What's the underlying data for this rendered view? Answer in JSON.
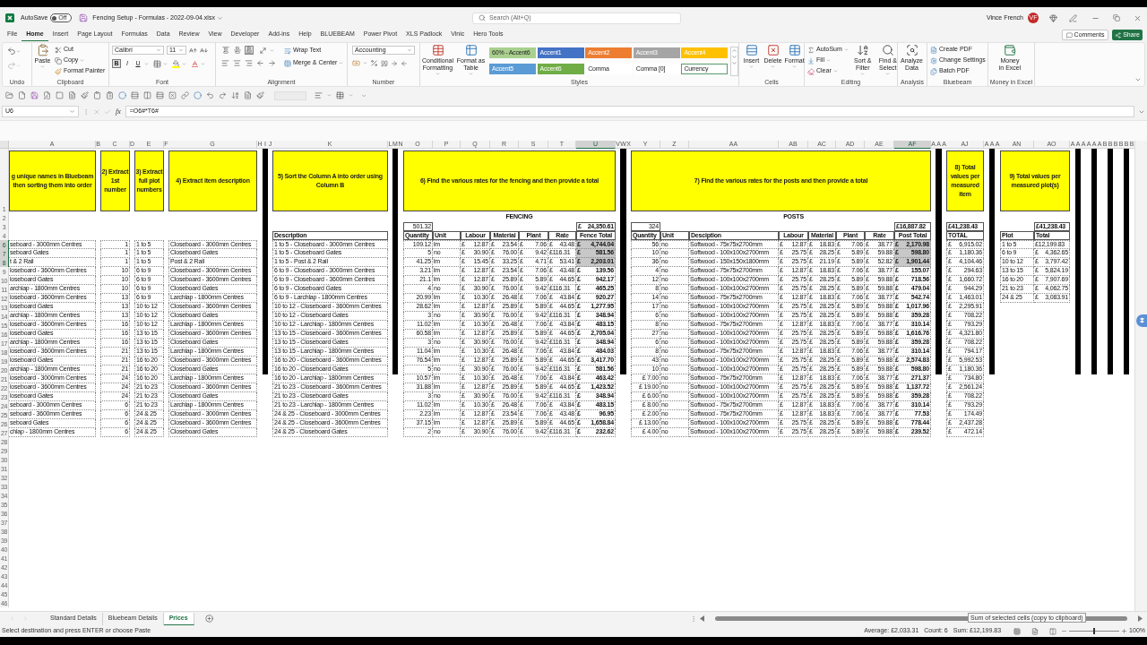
{
  "title_bar": {
    "autosave": {
      "label": "AutoSave",
      "state_label": "Off",
      "on": false
    },
    "file_name": "Fencing Setup - Formulas - 2022-09-04.xlsx",
    "search_placeholder": "Search (Alt+Q)",
    "user_name": "Vince French",
    "user_initials": "VF"
  },
  "menu_tabs": [
    {
      "label": "File",
      "selected": false
    },
    {
      "label": "Home",
      "selected": true
    },
    {
      "label": "Insert",
      "selected": false
    },
    {
      "label": "Page Layout",
      "selected": false
    },
    {
      "label": "Formulas",
      "selected": false
    },
    {
      "label": "Data",
      "selected": false
    },
    {
      "label": "Review",
      "selected": false
    },
    {
      "label": "View",
      "selected": false
    },
    {
      "label": "Developer",
      "selected": false
    },
    {
      "label": "Add-ins",
      "selected": false
    },
    {
      "label": "Help",
      "selected": false
    },
    {
      "label": "BLUEBEAM",
      "selected": false
    },
    {
      "label": "Power Pivot",
      "selected": false
    },
    {
      "label": "XLS Padlock",
      "selected": false
    },
    {
      "label": "Vinic",
      "selected": false
    },
    {
      "label": "Hero Tools",
      "selected": false
    }
  ],
  "comments": "Comments",
  "share": "Share",
  "ribbon": {
    "groups": [
      {
        "kind": "undo",
        "label": "Undo"
      },
      {
        "kind": "clipboard",
        "label": "Clipboard",
        "paste": "Paste",
        "items": [
          "Cut",
          "Copy",
          "Format Painter"
        ]
      },
      {
        "kind": "font",
        "label": "Font",
        "font": "Calibri",
        "size": "11",
        "format_buttons": [
          {
            "label": "B",
            "selected": true
          },
          {
            "label": "I",
            "selected": false
          },
          {
            "label": "U",
            "selected": false
          }
        ]
      },
      {
        "kind": "alignment",
        "label": "Alignment",
        "align_buttons": [
          {
            "selected": false
          },
          {
            "selected": false
          },
          {
            "selected": true
          }
        ],
        "wrap": "Wrap Text",
        "merge": "Merge & Center"
      },
      {
        "kind": "number",
        "label": "Number",
        "format": "Accounting"
      },
      {
        "kind": "styles",
        "label": "Styles",
        "conditional": "Conditional Formatting",
        "table": "Format as Table",
        "cells": [
          {
            "label": "60% - Accent6",
            "kind": "tint",
            "color": "#a9d08e",
            "selected": false
          },
          {
            "label": "Accent1",
            "kind": "accent",
            "color": "#4472c4",
            "selected": false
          },
          {
            "label": "Accent2",
            "kind": "accent",
            "color": "#ed7d31",
            "selected": false
          },
          {
            "label": "Accent3",
            "kind": "accent",
            "color": "#a5a5a5",
            "selected": false
          },
          {
            "label": "Accent4",
            "kind": "accent",
            "color": "#ffc000",
            "selected": false
          },
          {
            "label": "Accent5",
            "kind": "accent",
            "color": "#5b9bd5",
            "selected": false
          },
          {
            "label": "Accent6",
            "kind": "accent",
            "color": "#70ad47",
            "selected": false
          },
          {
            "label": "Comma",
            "kind": "number",
            "selected": false
          },
          {
            "label": "Comma [0]",
            "kind": "number",
            "selected": false
          },
          {
            "label": "Currency",
            "kind": "number",
            "selected": true
          }
        ]
      },
      {
        "kind": "cells",
        "label": "Cells",
        "buttons": [
          "Insert",
          "Delete",
          "Format"
        ]
      },
      {
        "kind": "editing",
        "label": "Editing",
        "items": [
          "AutoSum",
          "Fill",
          "Clear"
        ],
        "buttons": [
          "Sort & Filter",
          "Find & Select"
        ]
      },
      {
        "kind": "analysis",
        "label": "Analysis",
        "button": "Analyze Data"
      },
      {
        "kind": "bluebeam",
        "label": "Bluebeam",
        "items": [
          "Create PDF",
          "Change Settings",
          "Batch PDF"
        ]
      },
      {
        "kind": "money",
        "label": "Money in Excel",
        "button": "Money in Excel"
      }
    ]
  },
  "formula_bar": {
    "name_box": "U6",
    "function_label": "fx",
    "formula": "=O6#*T6#"
  },
  "sheet": {
    "column_headers": [
      {
        "label": "A",
        "selected": false
      },
      {
        "label": "B",
        "selected": false
      },
      {
        "label": "C",
        "selected": false
      },
      {
        "label": "D",
        "selected": false
      },
      {
        "label": "E",
        "selected": false
      },
      {
        "label": "F",
        "selected": false
      },
      {
        "label": "G",
        "selected": false
      },
      {
        "label": "H",
        "selected": false
      },
      {
        "label": "I",
        "selected": false
      },
      {
        "label": "J",
        "selected": false
      },
      {
        "label": "K",
        "selected": false
      },
      {
        "label": "L",
        "selected": false
      },
      {
        "label": "M",
        "selected": false
      },
      {
        "label": "N",
        "selected": false
      },
      {
        "label": "O",
        "selected": false
      },
      {
        "label": "P",
        "selected": false
      },
      {
        "label": "Q",
        "selected": false
      },
      {
        "label": "R",
        "selected": false
      },
      {
        "label": "S",
        "selected": false
      },
      {
        "label": "T",
        "selected": false
      },
      {
        "label": "U",
        "selected": true
      },
      {
        "label": "V",
        "selected": false
      },
      {
        "label": "W",
        "selected": false
      },
      {
        "label": "X",
        "selected": false
      },
      {
        "label": "Y",
        "selected": false
      },
      {
        "label": "Z",
        "selected": false
      },
      {
        "label": "AA",
        "selected": false
      },
      {
        "label": "AB",
        "selected": false
      },
      {
        "label": "AC",
        "selected": false
      },
      {
        "label": "AD",
        "selected": false
      },
      {
        "label": "AE",
        "selected": false
      },
      {
        "label": "AF",
        "selected": true
      },
      {
        "label": "A",
        "selected": false
      },
      {
        "label": "A",
        "selected": false
      },
      {
        "label": "A",
        "selected": false
      },
      {
        "label": "AJ",
        "selected": false
      },
      {
        "label": "A",
        "selected": false
      },
      {
        "label": "A",
        "selected": false
      },
      {
        "label": "A",
        "selected": false
      },
      {
        "label": "AN",
        "selected": false
      },
      {
        "label": "AO",
        "selected": false
      },
      {
        "label": "A",
        "selected": false
      },
      {
        "label": "A",
        "selected": false
      },
      {
        "label": "A",
        "selected": false
      },
      {
        "label": "A",
        "selected": false
      },
      {
        "label": "A",
        "selected": false
      },
      {
        "label": "A",
        "selected": false
      },
      {
        "label": "B",
        "selected": false
      },
      {
        "label": "B",
        "selected": false
      },
      {
        "label": "B",
        "selected": false
      },
      {
        "label": "B",
        "selected": false
      },
      {
        "label": "B",
        "selected": false
      },
      {
        "label": "B",
        "selected": false
      }
    ],
    "row_headers": [
      {
        "label": "1",
        "selected": false
      },
      {
        "label": "2",
        "selected": false
      },
      {
        "label": "3",
        "selected": false
      },
      {
        "label": "4",
        "selected": false
      },
      {
        "label": "6",
        "selected": true
      },
      {
        "label": "7",
        "selected": true
      },
      {
        "label": "8",
        "selected": true
      },
      {
        "label": "9",
        "selected": false
      },
      {
        "label": "10",
        "selected": false
      },
      {
        "label": "11",
        "selected": false
      },
      {
        "label": "12",
        "selected": false
      },
      {
        "label": "13",
        "selected": false
      },
      {
        "label": "14",
        "selected": false
      },
      {
        "label": "15",
        "selected": false
      },
      {
        "label": "16",
        "selected": false
      },
      {
        "label": "17",
        "selected": false
      },
      {
        "label": "18",
        "selected": false
      },
      {
        "label": "19",
        "selected": false
      },
      {
        "label": "20",
        "selected": false
      },
      {
        "label": "21",
        "selected": false
      },
      {
        "label": "22",
        "selected": false
      },
      {
        "label": "23",
        "selected": false
      },
      {
        "label": "24",
        "selected": false
      },
      {
        "label": "25",
        "selected": false
      },
      {
        "label": "26",
        "selected": false
      },
      {
        "label": "27",
        "selected": false
      },
      {
        "label": "28",
        "selected": false
      },
      {
        "label": "29",
        "selected": false
      },
      {
        "label": "30",
        "selected": false
      },
      {
        "label": "31",
        "selected": false
      },
      {
        "label": "32",
        "selected": false
      },
      {
        "label": "33",
        "selected": false
      },
      {
        "label": "34",
        "selected": false
      },
      {
        "label": "35",
        "selected": false
      },
      {
        "label": "36",
        "selected": false
      },
      {
        "label": "37",
        "selected": false
      },
      {
        "label": "38",
        "selected": false
      },
      {
        "label": "39",
        "selected": false
      },
      {
        "label": "40",
        "selected": false
      },
      {
        "label": "41",
        "selected": false
      },
      {
        "label": "42",
        "selected": false
      },
      {
        "label": "43",
        "selected": false
      },
      {
        "label": "44",
        "selected": false
      },
      {
        "label": "45",
        "selected": false
      },
      {
        "label": "46",
        "selected": false
      }
    ],
    "steps": [
      "g unique names in Bluebeam then sorting them into order",
      "2) Extract 1st number",
      "3) Extract full plot numbers",
      "4) Extract item description",
      "5) Sort the Column A into order using Column B",
      "6) Find the various rates for the fencing and then provide a total",
      "7) Find the various rates for the posts and then provide a total",
      "8) Total values per measured item",
      "9) Total values per measured plot(s)"
    ],
    "extract_list": [
      [
        "seboard - 3000mm Centres",
        "1",
        "1 to 5",
        "Closeboard - 3000mm Centres"
      ],
      [
        "seboard Gates",
        "1",
        "1 to 5",
        "Closeboard Gates"
      ],
      [
        "t & 2 Rail",
        "1",
        "1 to 5",
        "Post & 2 Rail"
      ],
      [
        "loseboard - 3600mm Centres",
        "10",
        "6 to 9",
        "Closeboard - 3000mm Centres"
      ],
      [
        "loseboard Gates",
        "10",
        "6 to 9",
        "Closeboard - 3600mm Centres"
      ],
      [
        "archlap - 1800mm Centres",
        "10",
        "6 to 9",
        "Closeboard Gates"
      ],
      [
        "loseboard - 3600mm Centres",
        "13",
        "6 to 9",
        "Larchlap - 1800mm Centres"
      ],
      [
        "loseboard Gates",
        "13",
        "10 to 12",
        "Closeboard - 3600mm Centres"
      ],
      [
        "archlap - 1800mm Centres",
        "13",
        "10 to 12",
        "Closeboard Gates"
      ],
      [
        "loseboard - 3600mm Centres",
        "16",
        "10 to 12",
        "Larchlap - 1800mm Centres"
      ],
      [
        "loseboard Gates",
        "16",
        "13 to 15",
        "Closeboard - 3600mm Centres"
      ],
      [
        "archlap - 1800mm Centres",
        "16",
        "13 to 15",
        "Closeboard Gates"
      ],
      [
        "loseboard - 3600mm Centres",
        "21",
        "13 to 15",
        "Larchlap - 1800mm Centres"
      ],
      [
        "loseboard Gates",
        "21",
        "16 to 20",
        "Closeboard - 3600mm Centres"
      ],
      [
        "archlap - 1800mm Centres",
        "21",
        "16 to 20",
        "Closeboard Gates"
      ],
      [
        "loseboard - 3000mm Centres",
        "24",
        "16 to 20",
        "Larchlap - 1800mm Centres"
      ],
      [
        "loseboard - 3600mm Centres",
        "24",
        "21 to 23",
        "Closeboard - 3600mm Centres"
      ],
      [
        "loseboard Gates",
        "24",
        "21 to 23",
        "Closeboard Gates"
      ],
      [
        "seboard - 3000mm Centres",
        "6",
        "21 to 23",
        "Larchlap - 1800mm Centres"
      ],
      [
        "seboard - 3600mm Centres",
        "6",
        "24 & 25",
        "Closeboard - 3000mm Centres"
      ],
      [
        "seboard Gates",
        "6",
        "24 & 25",
        "Closeboard - 3600mm Centres"
      ],
      [
        "chlap - 1800mm Centres",
        "6",
        "24 & 25",
        "Closeboard Gates"
      ]
    ],
    "sorted_list": {
      "heading": "Description",
      "rows": [
        "1 to 5 - Closeboard - 3000mm Centres",
        "1 to 5 - Closeboard Gates",
        "1 to 5 - Post & 2 Rail",
        "6 to 9 - Closeboard - 3000mm Centres",
        "6 to 9 - Closeboard - 3600mm Centres",
        "6 to 9 - Closeboard Gates",
        "6 to 9 - Larchlap - 1800mm Centres",
        "10 to 12 - Closeboard - 3600mm Centres",
        "10 to 12 - Closeboard Gates",
        "10 to 12 - Larchlap - 1800mm Centres",
        "13 to 15 - Closeboard - 3600mm Centres",
        "13 to 15 - Closeboard Gates",
        "13 to 15 - Larchlap - 1800mm Centres",
        "16 to 20 - Closeboard - 3600mm Centres",
        "16 to 20 - Closeboard Gates",
        "16 to 20 - Larchlap - 1800mm Centres",
        "21 to 23 - Closeboard - 3600mm Centres",
        "21 to 23 - Closeboard Gates",
        "21 to 23 - Larchlap - 1800mm Centres",
        "24 & 25 - Closeboard - 3000mm Centres",
        "24 & 25 - Closeboard - 3600mm Centres",
        "24 & 25 - Closeboard Gates"
      ]
    },
    "fencing": {
      "title": "FENCING",
      "quantity_total": "501.32",
      "grand_total": "£ 24,350.61",
      "columns": [
        "Quantity",
        "Unit",
        "Labour",
        "Material",
        "Plant",
        "Rate",
        "Fence Total"
      ],
      "rows": [
        {
          "cells": [
            "109.12",
            "lm",
            "£ 12.87",
            "£ 23.54",
            "£ 7.06",
            "£ 43.48",
            "£ 4,744.04"
          ],
          "selected": true
        },
        {
          "cells": [
            "5",
            "no",
            "£ 30.90",
            "£ 76.00",
            "£ 9.42",
            "£116.31",
            "£ 581.56"
          ],
          "selected": true
        },
        {
          "cells": [
            "41.25",
            "lm",
            "£ 15.45",
            "£ 33.25",
            "£ 4.71",
            "£ 53.41",
            "£ 2,203.01"
          ],
          "selected": true
        },
        {
          "cells": [
            "3.21",
            "lm",
            "£ 12.87",
            "£ 23.54",
            "£ 7.06",
            "£ 43.48",
            "£ 139.56"
          ],
          "selected": false
        },
        {
          "cells": [
            "21.1",
            "lm",
            "£ 12.87",
            "£ 25.89",
            "£ 5.89",
            "£ 44.65",
            "£ 942.17"
          ],
          "selected": false
        },
        {
          "cells": [
            "4",
            "no",
            "£ 30.90",
            "£ 76.00",
            "£ 9.42",
            "£116.31",
            "£ 465.25"
          ],
          "selected": false
        },
        {
          "cells": [
            "20.99",
            "lm",
            "£ 10.30",
            "£ 26.48",
            "£ 7.06",
            "£ 43.84",
            "£ 920.27"
          ],
          "selected": false
        },
        {
          "cells": [
            "28.62",
            "lm",
            "£ 12.87",
            "£ 25.89",
            "£ 5.89",
            "£ 44.65",
            "£ 1,277.95"
          ],
          "selected": false
        },
        {
          "cells": [
            "3",
            "no",
            "£ 30.90",
            "£ 76.00",
            "£ 9.42",
            "£116.31",
            "£ 348.94"
          ],
          "selected": false
        },
        {
          "cells": [
            "11.02",
            "lm",
            "£ 10.30",
            "£ 26.48",
            "£ 7.06",
            "£ 43.84",
            "£ 483.15"
          ],
          "selected": false
        },
        {
          "cells": [
            "60.58",
            "lm",
            "£ 12.87",
            "£ 25.89",
            "£ 5.89",
            "£ 44.65",
            "£ 2,705.04"
          ],
          "selected": false
        },
        {
          "cells": [
            "3",
            "no",
            "£ 30.90",
            "£ 76.00",
            "£ 9.42",
            "£116.31",
            "£ 348.94"
          ],
          "selected": false
        },
        {
          "cells": [
            "11.04",
            "lm",
            "£ 10.30",
            "£ 26.48",
            "£ 7.06",
            "£ 43.84",
            "£ 484.03"
          ],
          "selected": false
        },
        {
          "cells": [
            "76.54",
            "lm",
            "£ 12.87",
            "£ 25.89",
            "£ 5.89",
            "£ 44.65",
            "£ 3,417.70"
          ],
          "selected": false
        },
        {
          "cells": [
            "5",
            "no",
            "£ 30.90",
            "£ 76.00",
            "£ 9.42",
            "£116.31",
            "£ 581.56"
          ],
          "selected": false
        },
        {
          "cells": [
            "10.57",
            "lm",
            "£ 10.30",
            "£ 26.48",
            "£ 7.06",
            "£ 43.84",
            "£ 463.42"
          ],
          "selected": false
        },
        {
          "cells": [
            "31.88",
            "lm",
            "£ 12.87",
            "£ 25.89",
            "£ 5.89",
            "£ 44.65",
            "£ 1,423.52"
          ],
          "selected": false
        },
        {
          "cells": [
            "3",
            "no",
            "£ 30.90",
            "£ 76.00",
            "£ 9.42",
            "£116.31",
            "£ 348.94"
          ],
          "selected": false
        },
        {
          "cells": [
            "11.02",
            "lm",
            "£ 10.30",
            "£ 26.48",
            "£ 7.06",
            "£ 43.84",
            "£ 483.15"
          ],
          "selected": false
        },
        {
          "cells": [
            "2.23",
            "lm",
            "£ 12.87",
            "£ 23.54",
            "£ 7.06",
            "£ 43.48",
            "£ 96.95"
          ],
          "selected": false
        },
        {
          "cells": [
            "37.15",
            "lm",
            "£ 12.87",
            "£ 25.89",
            "£ 5.89",
            "£ 44.65",
            "£ 1,658.84"
          ],
          "selected": false
        },
        {
          "cells": [
            "2",
            "no",
            "£ 30.90",
            "£ 76.00",
            "£ 9.42",
            "£116.31",
            "£ 232.62"
          ],
          "selected": false
        }
      ]
    },
    "posts": {
      "title": "POSTS",
      "quantity_total": "324",
      "grand_total": "£16,887.82",
      "columns": [
        "Quantity",
        "Unit",
        "Desciption",
        "Labour",
        "Material",
        "Plant",
        "Rate",
        "Post Total"
      ],
      "rows": [
        {
          "cells": [
            "56",
            "no",
            "Softwood - 75x75x2700mm",
            "£ 12.87",
            "£ 18.83",
            "£ 7.06",
            "£ 38.77",
            "£ 2,170.98"
          ],
          "selected": true
        },
        {
          "cells": [
            "10",
            "no",
            "Softwood - 100x100x2700mm",
            "£ 25.75",
            "£ 28.25",
            "£ 5.89",
            "£ 59.88",
            "£ 598.80"
          ],
          "selected": true
        },
        {
          "cells": [
            "36",
            "no",
            "Softwood - 150x150x1800mm",
            "£ 25.75",
            "£ 21.19",
            "£ 5.89",
            "£ 52.82",
            "£ 1,901.44"
          ],
          "selected": true
        },
        {
          "cells": [
            "4",
            "no",
            "Softwood - 75x75x2700mm",
            "£ 12.87",
            "£ 18.83",
            "£ 7.06",
            "£ 38.77",
            "£ 155.07"
          ],
          "selected": false
        },
        {
          "cells": [
            "12",
            "no",
            "Softwood - 100x100x2700mm",
            "£ 25.75",
            "£ 28.25",
            "£ 5.89",
            "£ 59.88",
            "£ 718.56"
          ],
          "selected": false
        },
        {
          "cells": [
            "8",
            "no",
            "Softwood - 100x100x2700mm",
            "£ 25.75",
            "£ 28.25",
            "£ 5.89",
            "£ 59.88",
            "£ 479.04"
          ],
          "selected": false
        },
        {
          "cells": [
            "14",
            "no",
            "Softwood - 75x75x2700mm",
            "£ 12.87",
            "£ 18.83",
            "£ 7.06",
            "£ 38.77",
            "£ 542.74"
          ],
          "selected": false
        },
        {
          "cells": [
            "17",
            "no",
            "Softwood - 100x100x2700mm",
            "£ 25.75",
            "£ 28.25",
            "£ 5.89",
            "£ 59.88",
            "£ 1,017.96"
          ],
          "selected": false
        },
        {
          "cells": [
            "6",
            "no",
            "Softwood - 100x100x2700mm",
            "£ 25.75",
            "£ 28.25",
            "£ 5.89",
            "£ 59.88",
            "£ 359.28"
          ],
          "selected": false
        },
        {
          "cells": [
            "8",
            "no",
            "Softwood - 75x75x2700mm",
            "£ 12.87",
            "£ 18.83",
            "£ 7.06",
            "£ 38.77",
            "£ 310.14"
          ],
          "selected": false
        },
        {
          "cells": [
            "27",
            "no",
            "Softwood - 100x100x2700mm",
            "£ 25.75",
            "£ 28.25",
            "£ 5.89",
            "£ 59.88",
            "£ 1,616.76"
          ],
          "selected": false
        },
        {
          "cells": [
            "6",
            "no",
            "Softwood - 100x100x2700mm",
            "£ 25.75",
            "£ 28.25",
            "£ 5.89",
            "£ 59.88",
            "£ 359.28"
          ],
          "selected": false
        },
        {
          "cells": [
            "8",
            "no",
            "Softwood - 75x75x2700mm",
            "£ 12.87",
            "£ 18.83",
            "£ 7.06",
            "£ 38.77",
            "£ 310.14"
          ],
          "selected": false
        },
        {
          "cells": [
            "43",
            "no",
            "Softwood - 100x100x2700mm",
            "£ 25.75",
            "£ 28.25",
            "£ 5.89",
            "£ 59.88",
            "£ 2,574.83"
          ],
          "selected": false
        },
        {
          "cells": [
            "10",
            "no",
            "Softwood - 100x100x2700mm",
            "£ 25.75",
            "£ 28.25",
            "£ 5.89",
            "£ 59.88",
            "£ 598.80"
          ],
          "selected": false
        },
        {
          "cells": [
            "£ 7.00",
            "no",
            "Softwood - 75x75x2700mm",
            "£ 12.87",
            "£ 18.83",
            "£ 7.06",
            "£ 38.77",
            "£ 271.37"
          ],
          "selected": false
        },
        {
          "cells": [
            "£ 19.00",
            "no",
            "Softwood - 100x100x2700mm",
            "£ 25.75",
            "£ 28.25",
            "£ 5.89",
            "£ 59.88",
            "£ 1,137.72"
          ],
          "selected": false
        },
        {
          "cells": [
            "£ 6.00",
            "no",
            "Softwood - 100x100x2700mm",
            "£ 25.75",
            "£ 28.25",
            "£ 5.89",
            "£ 59.88",
            "£ 359.28"
          ],
          "selected": false
        },
        {
          "cells": [
            "£ 8.00",
            "no",
            "Softwood - 75x75x2700mm",
            "£ 12.87",
            "£ 18.83",
            "£ 7.06",
            "£ 38.77",
            "£ 310.14"
          ],
          "selected": false
        },
        {
          "cells": [
            "£ 2.00",
            "no",
            "Softwood - 75x75x2700mm",
            "£ 12.87",
            "£ 18.83",
            "£ 7.06",
            "£ 38.77",
            "£ 77.53"
          ],
          "selected": false
        },
        {
          "cells": [
            "£ 13.00",
            "no",
            "Softwood - 100x100x2700mm",
            "£ 25.75",
            "£ 28.25",
            "£ 5.89",
            "£ 59.88",
            "£ 778.44"
          ],
          "selected": false
        },
        {
          "cells": [
            "£ 4.00",
            "no",
            "Softwood - 100x100x2700mm",
            "£ 25.75",
            "£ 28.25",
            "£ 5.89",
            "£ 59.88",
            "£ 239.52"
          ],
          "selected": false
        }
      ]
    },
    "item_totals": {
      "grand_total": "£41,238.43",
      "heading": "TOTAL",
      "values": [
        "£ 6,915.02",
        "£ 1,180.36",
        "£ 4,104.46",
        "£ 294.63",
        "£ 1,660.72",
        "£ 944.29",
        "£ 1,463.01",
        "£ 2,295.91",
        "£ 708.22",
        "£ 793.29",
        "£ 4,321.80",
        "£ 708.22",
        "£ 794.17",
        "£ 5,992.53",
        "£ 1,180.36",
        "£ 734.80",
        "£ 2,561.24",
        "£ 708.22",
        "£ 793.29",
        "£ 174.49",
        "£ 2,437.28",
        "£ 472.14"
      ]
    },
    "plot_totals": {
      "grand_total": "£41,238.43",
      "headings": [
        "Plot",
        "Total"
      ],
      "rows": [
        [
          "1 to 5",
          "£12,199.83"
        ],
        [
          "6 to 9",
          "£ 4,362.65"
        ],
        [
          "10 to 12",
          "£ 3,797.42"
        ],
        [
          "13 to 15",
          "£ 5,824.19"
        ],
        [
          "16 to 20",
          "£ 7,907.69"
        ],
        [
          "21 to 23",
          "£ 4,062.75"
        ],
        [
          "24 & 25",
          "£ 3,083.91"
        ]
      ]
    }
  },
  "sheet_tabs": [
    {
      "label": "Standard Details",
      "selected": false
    },
    {
      "label": "Bluebeam Details",
      "selected": false
    },
    {
      "label": "Prices",
      "selected": true
    }
  ],
  "status_bar": {
    "message": "Select destination and press ENTER or choose Paste",
    "average": "Average: £2,033.31",
    "count": "Count: 6",
    "sum": "Sum: £12,199.83",
    "zoom": {
      "label": "100%",
      "level": 0.5
    },
    "tooltip": "Sum of selected cells (copy to clipboard)"
  }
}
